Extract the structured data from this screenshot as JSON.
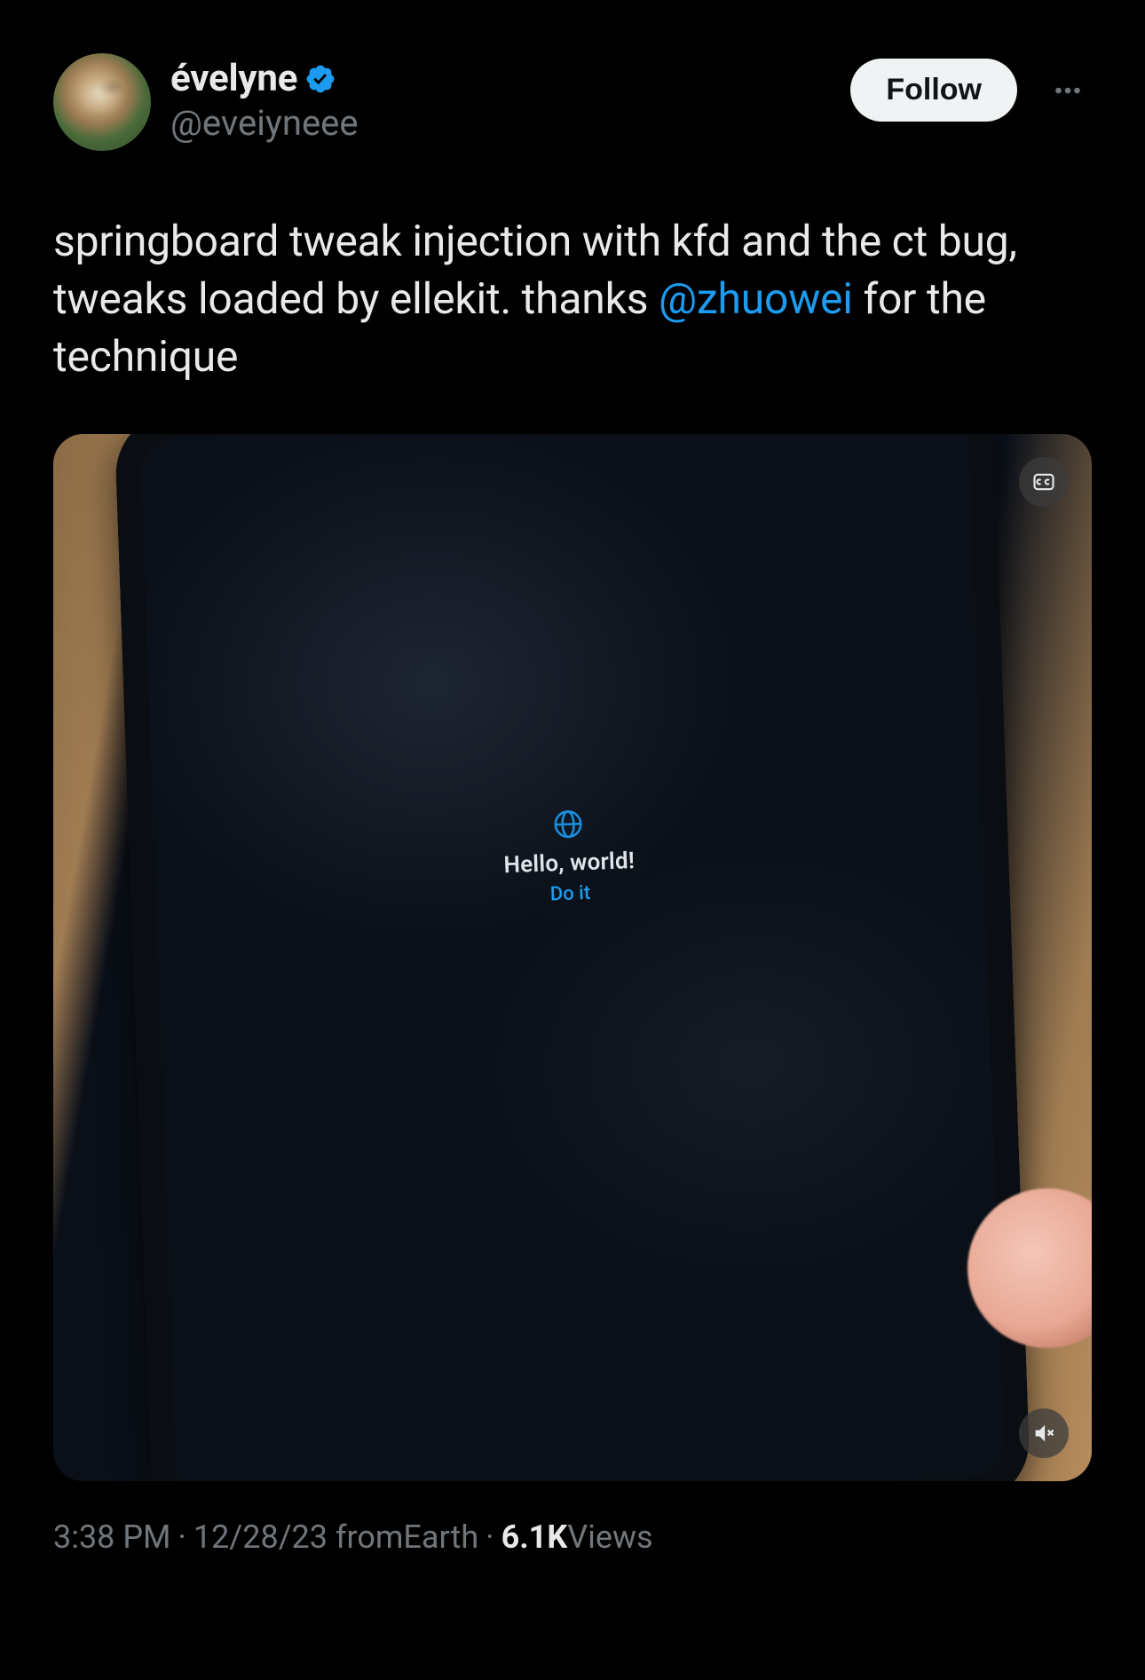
{
  "author": {
    "display_name": "évelyne",
    "handle": "@eveiyneee",
    "verified": true
  },
  "actions": {
    "follow_label": "Follow"
  },
  "tweet": {
    "text_before_mention": "springboard tweak injection with kfd and the ct bug, tweaks loaded by ellekit. thanks ",
    "mention": "@zhuowei",
    "text_after_mention": " for the technique"
  },
  "media": {
    "phone_text_top": "Hello, world!",
    "phone_text_bottom": "Do it"
  },
  "meta": {
    "time": "3:38 PM",
    "date": "12/28/23",
    "location_prefix": "from ",
    "location": "Earth",
    "views_count": "6.1K",
    "views_label": " Views"
  }
}
